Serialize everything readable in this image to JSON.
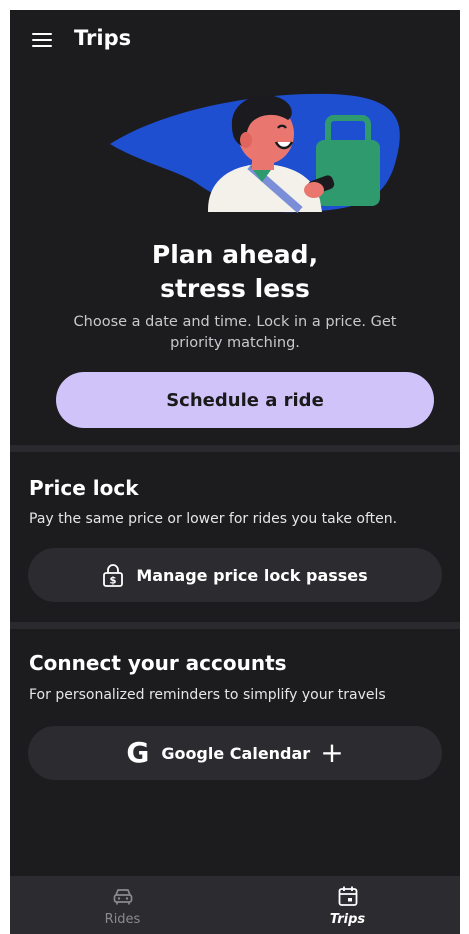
{
  "header": {
    "title": "Trips",
    "menu_icon": "hamburger-menu-icon"
  },
  "hero": {
    "title_line1": "Plan ahead,",
    "title_line2": "stress less",
    "subtitle": "Choose a date and time. Lock in a price. Get priority matching.",
    "cta_label": "Schedule a ride"
  },
  "price_lock": {
    "title": "Price lock",
    "description": "Pay the same price or lower for rides you take often.",
    "button_label": "Manage price lock passes",
    "button_icon": "lock-dollar-icon"
  },
  "accounts": {
    "title": "Connect your accounts",
    "description": "For personalized reminders to simplify your travels",
    "button_label": "Google Calendar",
    "button_icon": "google-g-icon",
    "button_glyph": "G",
    "plus_glyph": "+"
  },
  "bottom_nav": {
    "items": [
      {
        "label": "Rides",
        "icon": "car-icon",
        "active": false
      },
      {
        "label": "Trips",
        "icon": "calendar-icon",
        "active": true
      }
    ]
  },
  "colors": {
    "background": "#1c1c1f",
    "accent": "#cfc3fa",
    "pill": "#2c2c30",
    "nav_bg": "#2b2b30",
    "illustration_blue": "#1f4fd1"
  }
}
